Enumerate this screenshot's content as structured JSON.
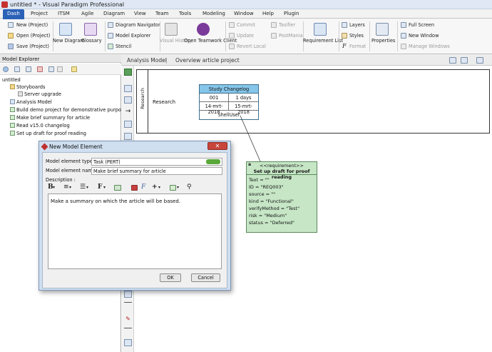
{
  "window": {
    "title": "untitled * - Visual Paradigm Professional"
  },
  "menu": [
    "Dash",
    "Project",
    "ITSM",
    "Agile",
    "Diagram",
    "View",
    "Team",
    "Tools",
    "Modeling",
    "Window",
    "Help",
    "Plugin"
  ],
  "ribbon": {
    "new_project": "New (Project)",
    "open_project": "Open (Project)",
    "save_project": "Save (Project)",
    "new_diagram": "New Diagram",
    "glossary": "Glossary",
    "diagram_navigator": "Diagram Navigator",
    "model_explorer": "Model Explorer",
    "stencil": "Stencil",
    "visual_history": "Visual History",
    "open_teamwork": "Open Teamwork Client",
    "commit": "Commit",
    "update": "Update",
    "revert_local": "Revert Local",
    "tasifier": "Tasifier",
    "postmania": "PostMania",
    "requirement_list": "Requirement List",
    "layers": "Layers",
    "styles": "Styles",
    "format": "Format",
    "properties": "Properties",
    "full_screen": "Full Screen",
    "new_window": "New Window",
    "manage_windows": "Manage Windows"
  },
  "model_explorer": {
    "title": "Model Explorer",
    "items": [
      "untitled",
      "Storyboards",
      "Server upgrade",
      "Analysis Model",
      "Build demo project for demonstrative purposes",
      "Make brief summary for article",
      "Read v15.0 changelog",
      "Set up draft for proof reading"
    ]
  },
  "breadcrumb": [
    "Analysis Model",
    "Overview article project"
  ],
  "diagram": {
    "lane_label": "Research",
    "row_label": "Research",
    "card": {
      "title": "Study Changelog",
      "id": "001",
      "duration": "1 days",
      "start": "14-mrt-2018",
      "end": "15-mrt-2018",
      "owner": "ShellUser"
    },
    "requirement": {
      "stereotype": "<<requirement>>",
      "name": "Set up draft for proof reading",
      "fields": [
        "Text = \"\"",
        "ID = \"REQ003\"",
        "source = \"\"",
        "kind = \"Functional\"",
        "verifyMethod = \"Test\"",
        "risk = \"Medium\"",
        "status = \"Deferred\""
      ]
    }
  },
  "dialog": {
    "title": "New Model Element",
    "type_label": "Model element type :",
    "type_value": "Task (PERT)",
    "name_label": "Model element name :",
    "name_value": "Make brief summary for article",
    "desc_label": "Description :",
    "desc_value": "Make a summary on which the article will be based.",
    "ok": "OK",
    "cancel": "Cancel"
  },
  "colors": {
    "accent": "#2b62b8",
    "card_header": "#86c6ea",
    "requirement_fill": "#c6e6c6",
    "close_red": "#c8453a"
  }
}
